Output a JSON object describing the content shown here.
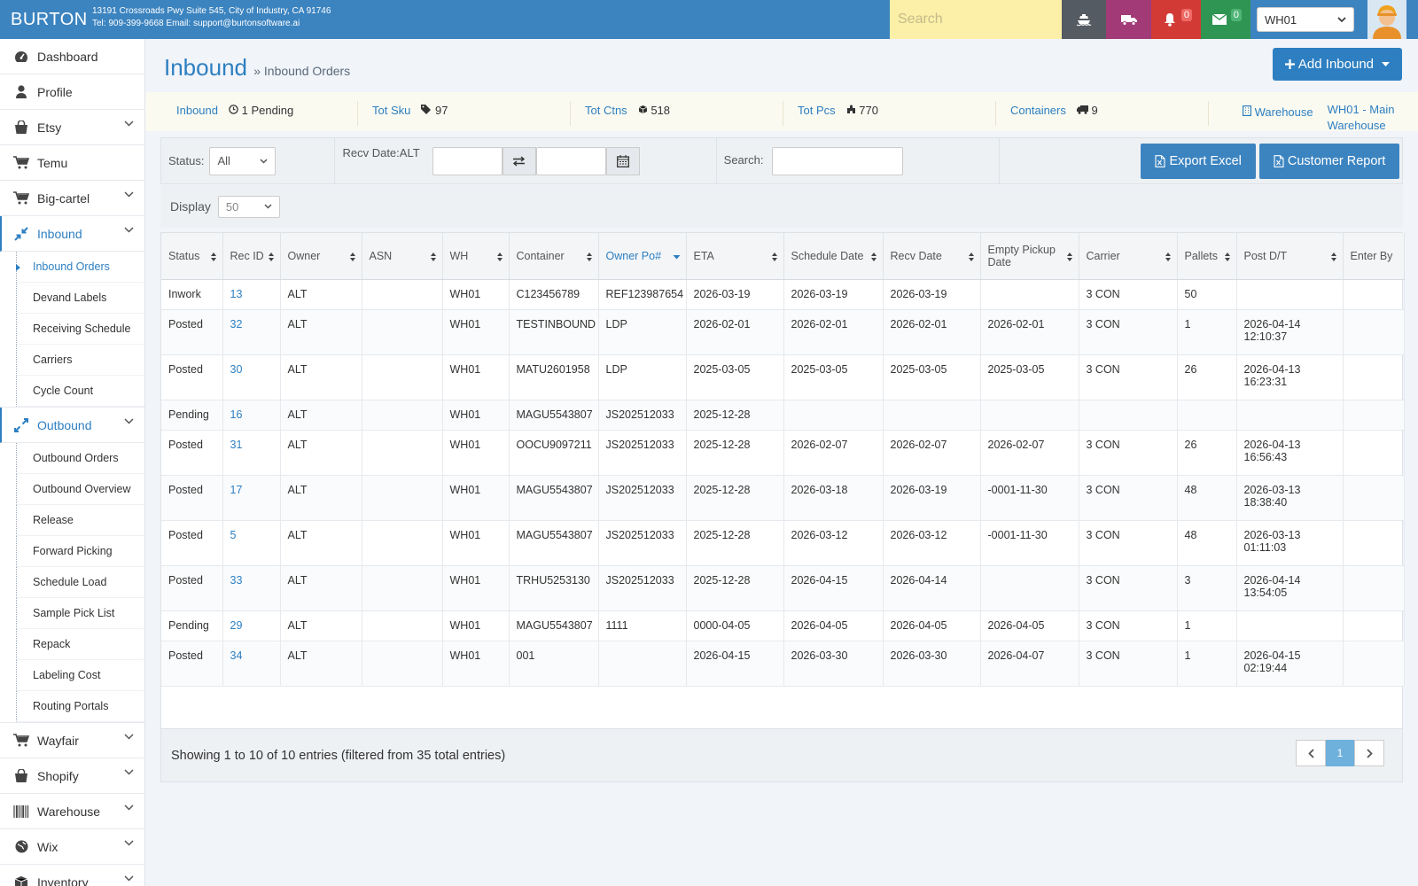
{
  "topbar": {
    "brand": "BURTON",
    "address_line": "13191 Crossroads Pwy Suite 545, City of Industry, CA 91746",
    "contact_line": "Tel: 909-399-9668 Email: support@burtonsoftware.ai",
    "search_placeholder": "Search",
    "bell_count": "0",
    "mail_count": "0",
    "warehouse_select": "WH01",
    "colors": {
      "bar": "#3c84c0",
      "search": "#fcefa8",
      "ship": "#555b62",
      "truck": "#a23a78",
      "bell": "#d23b35",
      "mail": "#2f9553"
    }
  },
  "sidebar": {
    "items": [
      {
        "label": "Dashboard",
        "icon": "dashboard-icon"
      },
      {
        "label": "Profile",
        "icon": "user-icon"
      },
      {
        "label": "Etsy",
        "icon": "bag-icon"
      },
      {
        "label": "Temu",
        "icon": "cart-icon"
      },
      {
        "label": "Big-cartel",
        "icon": "cart-icon"
      },
      {
        "label": "Inbound",
        "icon": "compress-icon"
      },
      {
        "label": "Outbound",
        "icon": "expand-icon"
      },
      {
        "label": "Wayfair",
        "icon": "cart-icon"
      },
      {
        "label": "Shopify",
        "icon": "bag-icon"
      },
      {
        "label": "Warehouse",
        "icon": "barcode-icon"
      },
      {
        "label": "Wix",
        "icon": "globe-icon"
      },
      {
        "label": "Inventory",
        "icon": "box-icon"
      }
    ],
    "inbound_sub": [
      "Inbound Orders",
      "Devand Labels",
      "Receiving Schedule",
      "Carriers",
      "Cycle Count"
    ],
    "outbound_sub": [
      "Outbound Orders",
      "Outbound Overview",
      "Release",
      "Forward Picking",
      "Schedule Load",
      "Sample Pick List",
      "Repack",
      "Labeling Cost",
      "Routing Portals"
    ]
  },
  "header": {
    "title": "Inbound",
    "subtitle": "» Inbound Orders",
    "add_button": "Add Inbound"
  },
  "stats": {
    "inbound_label": "Inbound",
    "inbound_value": "1 Pending",
    "sku_label": "Tot Sku",
    "sku_value": "97",
    "ctns_label": "Tot Ctns",
    "ctns_value": "518",
    "pcs_label": "Tot Pcs",
    "pcs_value": "770",
    "containers_label": "Containers",
    "containers_value": "9",
    "warehouse_label": "Warehouse",
    "warehouse_value": "WH01 - Main Warehouse"
  },
  "filters": {
    "status_label": "Status:",
    "status_value": "All",
    "recv_label": "Recv Date:ALT",
    "search_label": "Search:",
    "export_button": "Export Excel",
    "report_button": "Customer Report",
    "display_label": "Display",
    "display_value": "50"
  },
  "table": {
    "columns": [
      "Status",
      "Rec ID",
      "Owner",
      "ASN",
      "WH",
      "Container",
      "Owner Po#",
      "ETA",
      "Schedule Date",
      "Recv Date",
      "Empty Pickup Date",
      "Carrier",
      "Pallets",
      "Post D/T",
      "Enter By"
    ],
    "rows": [
      [
        "Inwork",
        "13",
        "ALT",
        "",
        "WH01",
        "C123456789",
        "REF123987654",
        "2026-03-19",
        "2026-03-19",
        "2026-03-19",
        "",
        "3 CON",
        "50",
        "",
        ""
      ],
      [
        "Posted",
        "32",
        "ALT",
        "",
        "WH01",
        "TESTINBOUND",
        "LDP",
        "2026-02-01",
        "2026-02-01",
        "2026-02-01",
        "2026-02-01",
        "3 CON",
        "1",
        "2026-04-14 12:10:37",
        ""
      ],
      [
        "Posted",
        "30",
        "ALT",
        "",
        "WH01",
        "MATU2601958",
        "LDP",
        "2025-03-05",
        "2025-03-05",
        "2025-03-05",
        "2025-03-05",
        "3 CON",
        "26",
        "2026-04-13 16:23:31",
        ""
      ],
      [
        "Pending",
        "16",
        "ALT",
        "",
        "WH01",
        "MAGU5543807",
        "JS202512033",
        "2025-12-28",
        "",
        "",
        "",
        "",
        "",
        "",
        ""
      ],
      [
        "Posted",
        "31",
        "ALT",
        "",
        "WH01",
        "OOCU9097211",
        "JS202512033",
        "2025-12-28",
        "2026-02-07",
        "2026-02-07",
        "2026-02-07",
        "3 CON",
        "26",
        "2026-04-13 16:56:43",
        ""
      ],
      [
        "Posted",
        "17",
        "ALT",
        "",
        "WH01",
        "MAGU5543807",
        "JS202512033",
        "2025-12-28",
        "2026-03-18",
        "2026-03-19",
        "-0001-11-30",
        "3 CON",
        "48",
        "2026-03-13 18:38:40",
        ""
      ],
      [
        "Posted",
        "5",
        "ALT",
        "",
        "WH01",
        "MAGU5543807",
        "JS202512033",
        "2025-12-28",
        "2026-03-12",
        "2026-03-12",
        "-0001-11-30",
        "3 CON",
        "48",
        "2026-03-13 01:11:03",
        ""
      ],
      [
        "Posted",
        "33",
        "ALT",
        "",
        "WH01",
        "TRHU5253130",
        "JS202512033",
        "2025-12-28",
        "2026-04-15",
        "2026-04-14",
        "",
        "3 CON",
        "3",
        "2026-04-14 13:54:05",
        ""
      ],
      [
        "Pending",
        "29",
        "ALT",
        "",
        "WH01",
        "MAGU5543807",
        "1111",
        "0000-04-05",
        "2026-04-05",
        "2026-04-05",
        "2026-04-05",
        "3 CON",
        "1",
        "",
        ""
      ],
      [
        "Posted",
        "34",
        "ALT",
        "",
        "WH01",
        "001",
        "",
        "2026-04-15",
        "2026-03-30",
        "2026-03-30",
        "2026-04-07",
        "3 CON",
        "1",
        "2026-04-15 02:19:44",
        ""
      ]
    ]
  },
  "footer": {
    "showing": "Showing 1 to 10 of 10 entries (filtered from 35 total entries)",
    "page": "1"
  }
}
